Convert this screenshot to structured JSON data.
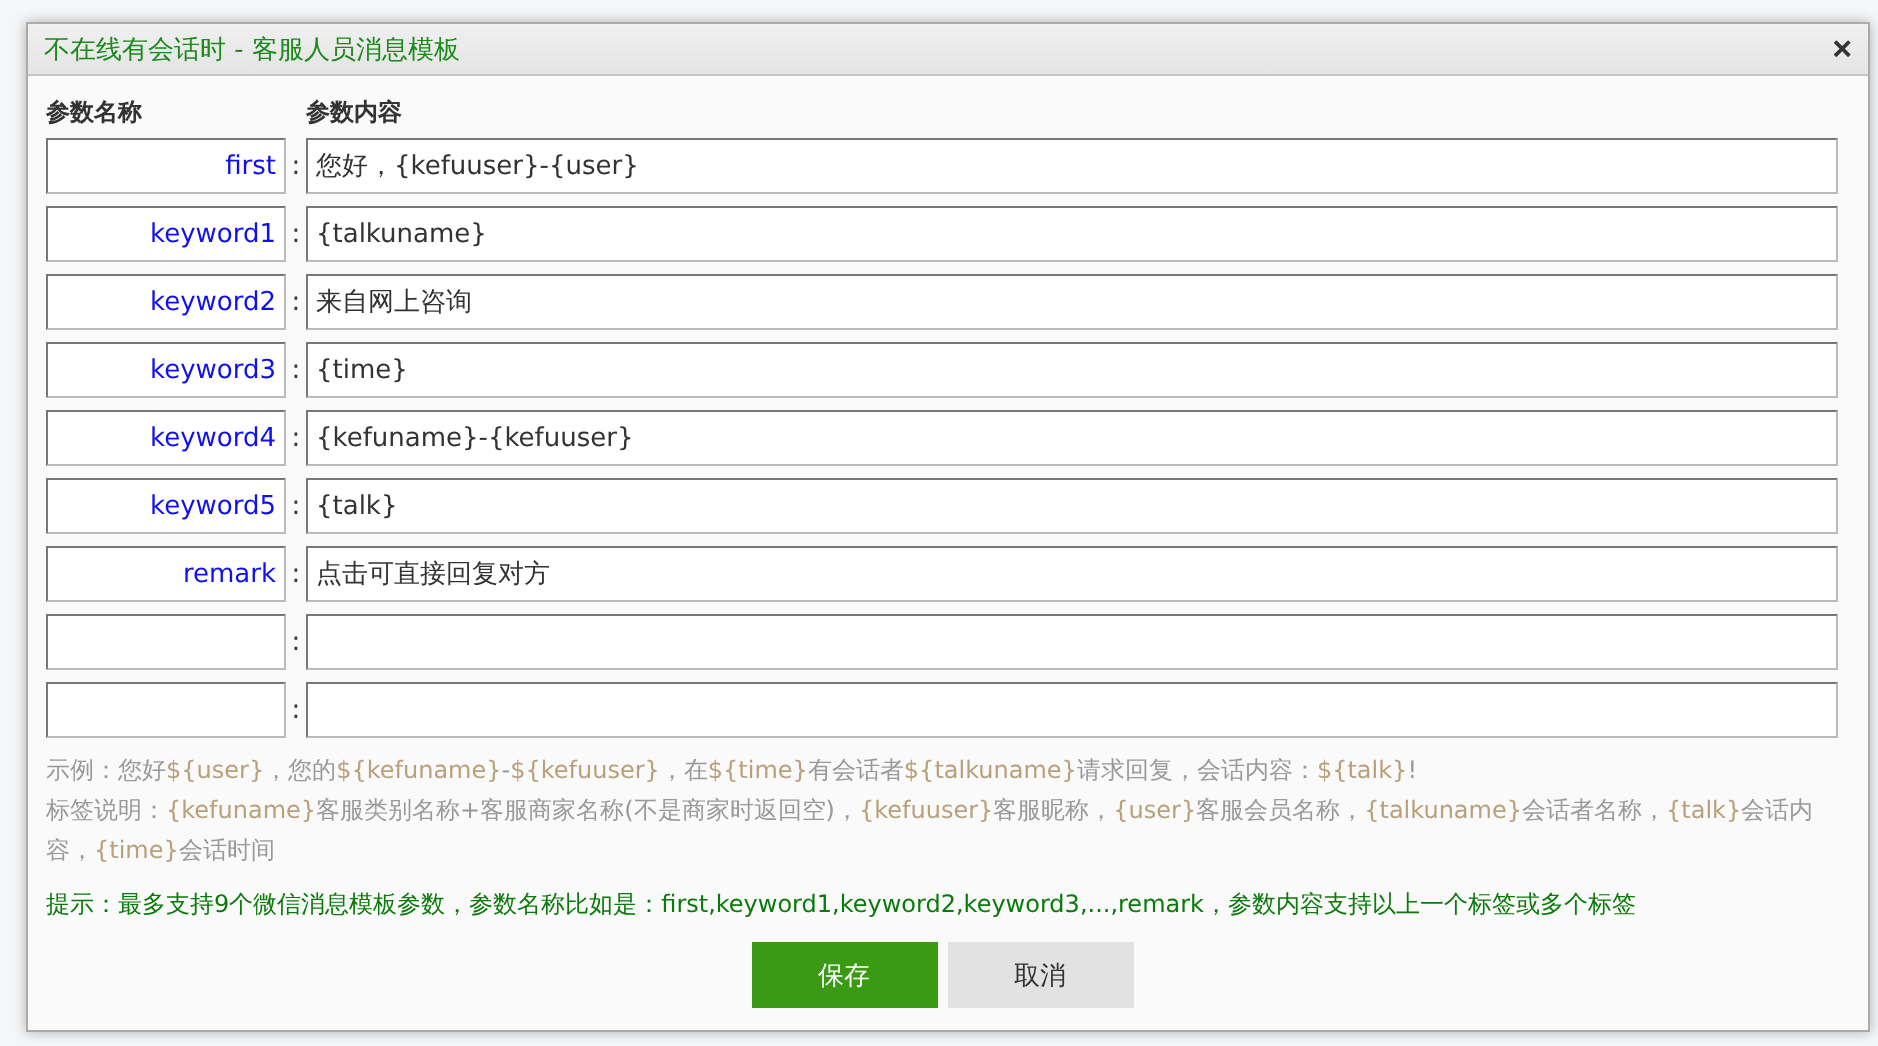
{
  "dialog": {
    "title": "不在线有会话时 - 客服人员消息模板",
    "close": "×"
  },
  "columns": [
    "参数名称",
    "参数内容"
  ],
  "separator": ":",
  "rows": [
    {
      "name": "first",
      "value": "您好，{kefuuser}-{user}"
    },
    {
      "name": "keyword1",
      "value": "{talkuname}"
    },
    {
      "name": "keyword2",
      "value": "来自网上咨询"
    },
    {
      "name": "keyword3",
      "value": "{time}"
    },
    {
      "name": "keyword4",
      "value": "{kefuname}-{kefuuser}"
    },
    {
      "name": "keyword5",
      "value": "{talk}"
    },
    {
      "name": "remark",
      "value": "点击可直接回复对方"
    },
    {},
    {}
  ],
  "example": "示例：您好${user}，您的${kefuname}-${kefuuser}，在${time}有会话者${talkuname}请求回复，会话内容：${talk}!",
  "legend": "标签说明：{kefuname}客服类别名称+客服商家名称(不是商家时返回空)，{kefuuser}客服昵称，{user}客服会员名称，{talkuname}会话者名称，{talk}会话内容，{time}会话时间",
  "tip": "提示：最多支持9个微信消息模板参数，参数名称比如是：first,keyword1,keyword2,keyword3,...,remark，参数内容支持以上一个标签或多个标签",
  "buttons": [
    {
      "label": "保存",
      "kind": "primary"
    },
    {
      "label": "取消",
      "kind": "secondary"
    }
  ]
}
